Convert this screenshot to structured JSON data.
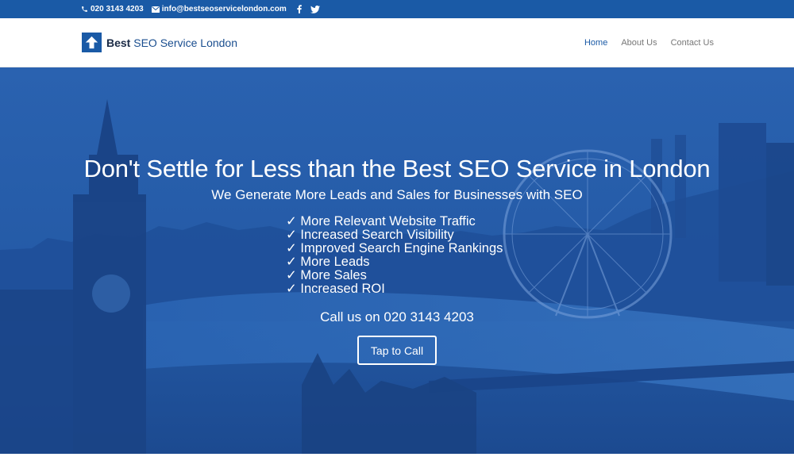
{
  "topbar": {
    "phone": "020 3143 4203",
    "email": "info@bestseoservicelondon.com",
    "icons": {
      "phone": "phone-icon",
      "email": "envelope-icon",
      "facebook": "facebook-icon",
      "twitter": "twitter-icon"
    }
  },
  "header": {
    "logo_word1": "Best",
    "logo_word2": "SEO Service London",
    "nav": [
      {
        "label": "Home",
        "active": true
      },
      {
        "label": "About Us",
        "active": false
      },
      {
        "label": "Contact Us",
        "active": false
      }
    ]
  },
  "hero": {
    "title": "Don't Settle for Less than the Best SEO Service in London",
    "subtitle": "We Generate More Leads and Sales for Businesses with SEO",
    "benefits": [
      "✓ More Relevant Website Traffic",
      "✓ Increased Search Visibility",
      "✓ Improved Search Engine Rankings",
      "✓ More Leads",
      "✓ More Sales",
      "✓ Increased ROI"
    ],
    "call_text": "Call us on 020 3143 4203",
    "cta_label": "Tap to Call"
  },
  "colors": {
    "brand": "#1a5aa6",
    "hero_overlay": "#1e4c96",
    "nav_active": "#1a5aa6",
    "nav_default": "#777777"
  }
}
